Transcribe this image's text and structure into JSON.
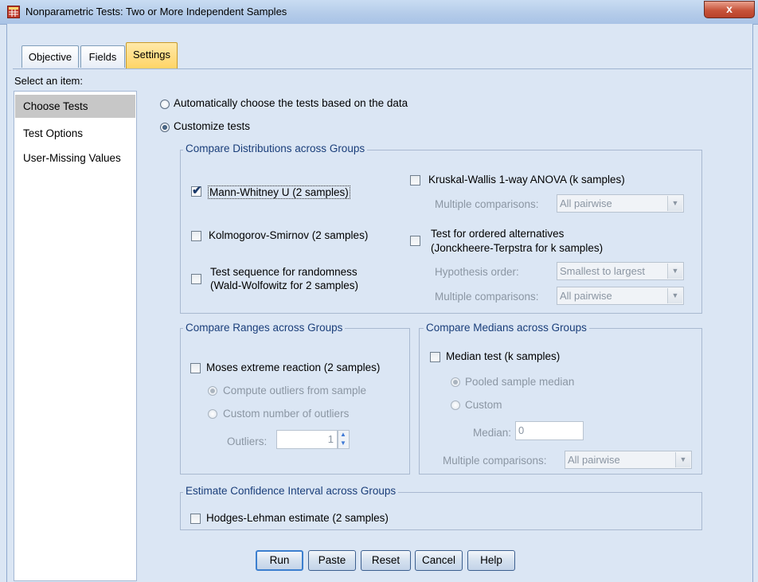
{
  "window": {
    "title": "Nonparametric Tests: Two or More Independent Samples",
    "close_label": "x"
  },
  "tabs": [
    {
      "label": "Objective",
      "active": false
    },
    {
      "label": "Fields",
      "active": false
    },
    {
      "label": "Settings",
      "active": true
    }
  ],
  "sidebar": {
    "heading": "Select an item:",
    "items": [
      {
        "label": "Choose Tests",
        "selected": true
      },
      {
        "label": "Test Options",
        "selected": false
      },
      {
        "label": "User-Missing Values",
        "selected": false
      }
    ]
  },
  "mode": {
    "auto_label": "Automatically choose the tests based on the data",
    "custom_label": "Customize tests",
    "selected": "custom"
  },
  "distributions": {
    "title": "Compare Distributions across Groups",
    "mann_whitney": {
      "label": "Mann-Whitney U (2 samples)",
      "checked": true
    },
    "kolmogorov": {
      "label": "Kolmogorov-Smirnov (2 samples)",
      "checked": false
    },
    "runs_line1": "Test sequence for randomness",
    "runs_line2": "(Wald-Wolfowitz for 2 samples)",
    "runs_checked": false,
    "kruskal": {
      "label": "Kruskal-Wallis 1-way ANOVA (k samples)",
      "checked": false
    },
    "kruskal_mc_label": "Multiple comparisons:",
    "kruskal_mc_value": "All pairwise",
    "ordered_line1": "Test for ordered alternatives",
    "ordered_line2": "(Jonckheere-Terpstra for k samples)",
    "ordered_checked": false,
    "hyp_label": "Hypothesis order:",
    "hyp_value": "Smallest to largest",
    "ordered_mc_label": "Multiple comparisons:",
    "ordered_mc_value": "All pairwise"
  },
  "ranges": {
    "title": "Compare Ranges across Groups",
    "moses": {
      "label": "Moses extreme reaction (2 samples)",
      "checked": false
    },
    "compute_label": "Compute outliers from sample",
    "custom_label": "Custom number of outliers",
    "outliers_label": "Outliers:",
    "outliers_value": "1"
  },
  "medians": {
    "title": "Compare Medians across Groups",
    "median_test": {
      "label": "Median test (k samples)",
      "checked": false
    },
    "pooled_label": "Pooled sample median",
    "custom_label": "Custom",
    "median_label": "Median:",
    "median_value": "0",
    "mc_label": "Multiple comparisons:",
    "mc_value": "All pairwise"
  },
  "confidence": {
    "title": "Estimate Confidence Interval across Groups",
    "hodges": {
      "label": "Hodges-Lehman estimate (2 samples)",
      "checked": false
    }
  },
  "buttons": {
    "run": "Run",
    "paste": "Paste",
    "reset": "Reset",
    "cancel": "Cancel",
    "help": "Help"
  },
  "colors": {
    "group_title": "#1a3e7a",
    "active_tab": "#ffd466",
    "background": "#dbe6f4"
  }
}
